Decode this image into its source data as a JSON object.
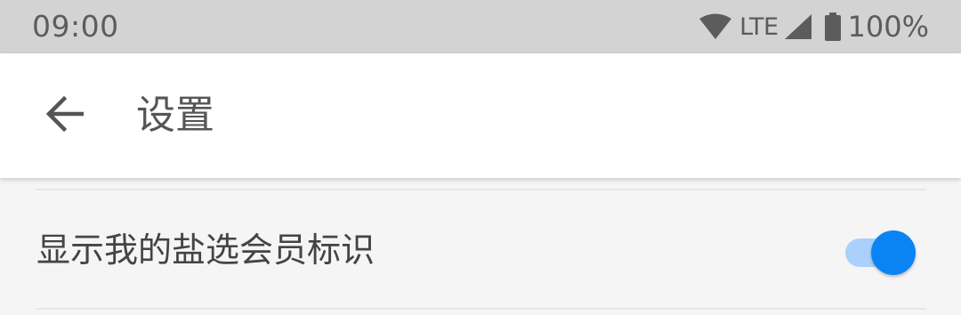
{
  "status_bar": {
    "time": "09:00",
    "network": "LTE",
    "battery": "100%",
    "icons": [
      "wifi-icon",
      "cell-signal-icon",
      "battery-icon"
    ]
  },
  "app_bar": {
    "back_icon": "arrow-left-icon",
    "title": "设置"
  },
  "settings": {
    "items": [
      {
        "label": "显示我的盐选会员标识",
        "enabled": true
      }
    ]
  },
  "colors": {
    "accent": "#0a84f5",
    "accent_track": "#a9d1fb",
    "status_bar": "#d3d3d3",
    "background": "#f5f5f5"
  }
}
